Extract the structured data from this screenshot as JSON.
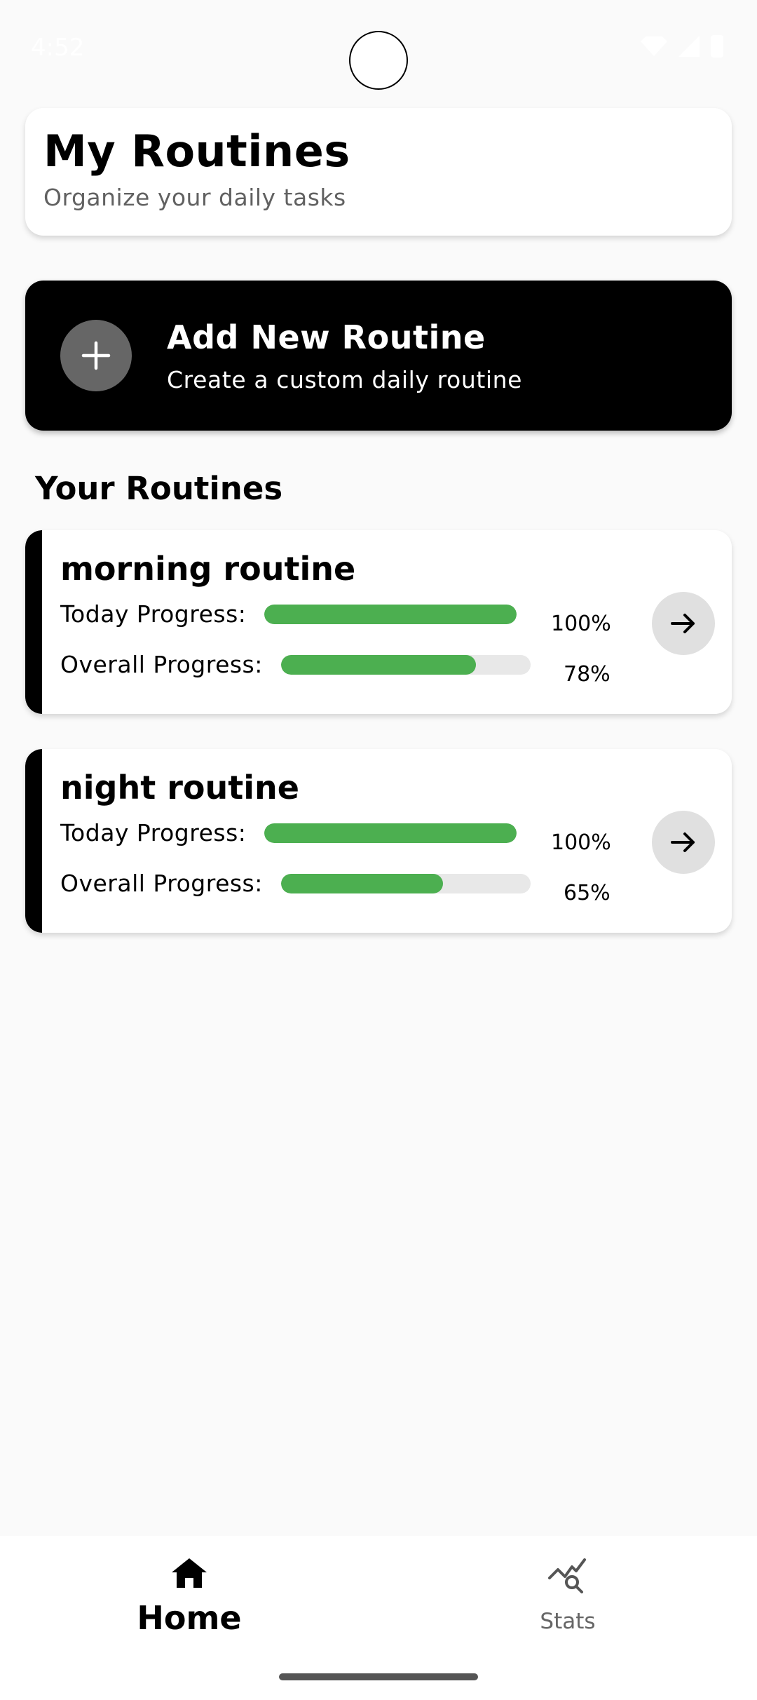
{
  "status_bar": {
    "time": "4:52"
  },
  "header": {
    "title": "My Routines",
    "subtitle": "Organize your daily tasks"
  },
  "add_card": {
    "icon": "plus-icon",
    "title": "Add New Routine",
    "subtitle": "Create a custom daily routine"
  },
  "section_title": "Your Routines",
  "routines": [
    {
      "name": "morning routine",
      "today_label": "Today Progress:",
      "today_percent": "100%",
      "today_value": 1.0,
      "overall_label": "Overall Progress:",
      "overall_percent": "78%",
      "overall_value": 0.78
    },
    {
      "name": "night routine",
      "today_label": "Today Progress:",
      "today_percent": "100%",
      "today_value": 1.0,
      "overall_label": "Overall Progress:",
      "overall_percent": "65%",
      "overall_value": 0.65
    }
  ],
  "nav": {
    "home": {
      "label": "Home",
      "icon": "home-icon"
    },
    "stats": {
      "label": "Stats",
      "icon": "stats-search-icon"
    }
  },
  "colors": {
    "progress": "#4caf50",
    "track": "#e8e8e8",
    "accent": "#000000"
  }
}
